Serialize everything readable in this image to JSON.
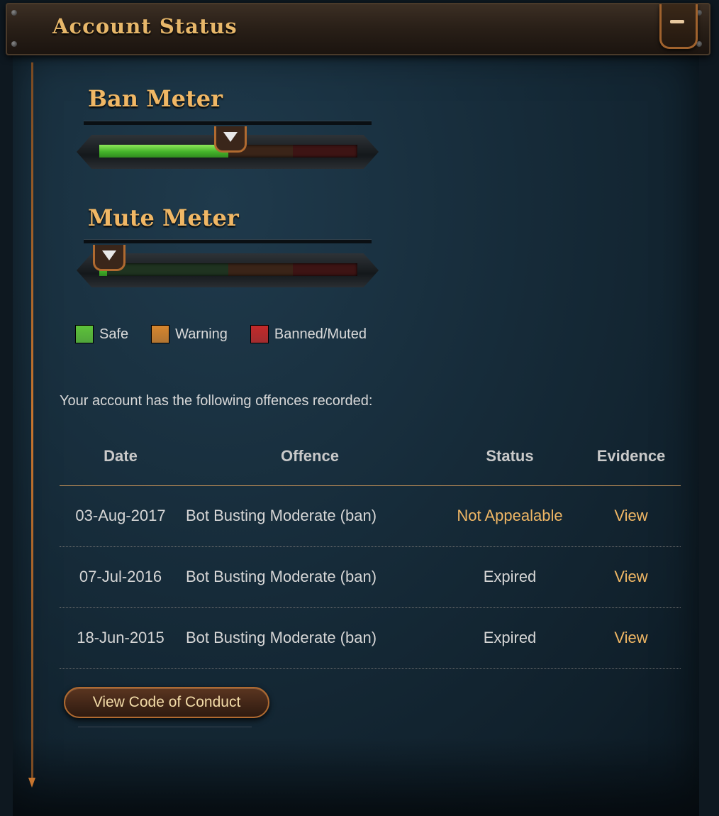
{
  "window": {
    "title": "Account Status"
  },
  "ban_meter": {
    "title": "Ban Meter",
    "fill_percent": 50
  },
  "mute_meter": {
    "title": "Mute Meter",
    "fill_percent": 3
  },
  "legend": [
    {
      "label": "Safe",
      "color": "#5ec23a"
    },
    {
      "label": "Warning",
      "color": "#d7862e"
    },
    {
      "label": "Banned/Muted",
      "color": "#c32a2a"
    }
  ],
  "intro": "Your account has the following offences recorded:",
  "table": {
    "headers": {
      "date": "Date",
      "offence": "Offence",
      "status": "Status",
      "evidence": "Evidence"
    },
    "rows": [
      {
        "date": "03-Aug-2017",
        "offence": "Bot Busting Moderate (ban)",
        "status": "Not Appealable",
        "evidence": "View"
      },
      {
        "date": "07-Jul-2016",
        "offence": "Bot Busting Moderate (ban)",
        "status": "Expired",
        "evidence": "View"
      },
      {
        "date": "18-Jun-2015",
        "offence": "Bot Busting Moderate (ban)",
        "status": "Expired",
        "evidence": "View"
      }
    ]
  },
  "buttons": {
    "code_of_conduct": "View Code of Conduct"
  },
  "colors": {
    "accent": "#f0b765",
    "highlight_status": "#f0b765"
  }
}
